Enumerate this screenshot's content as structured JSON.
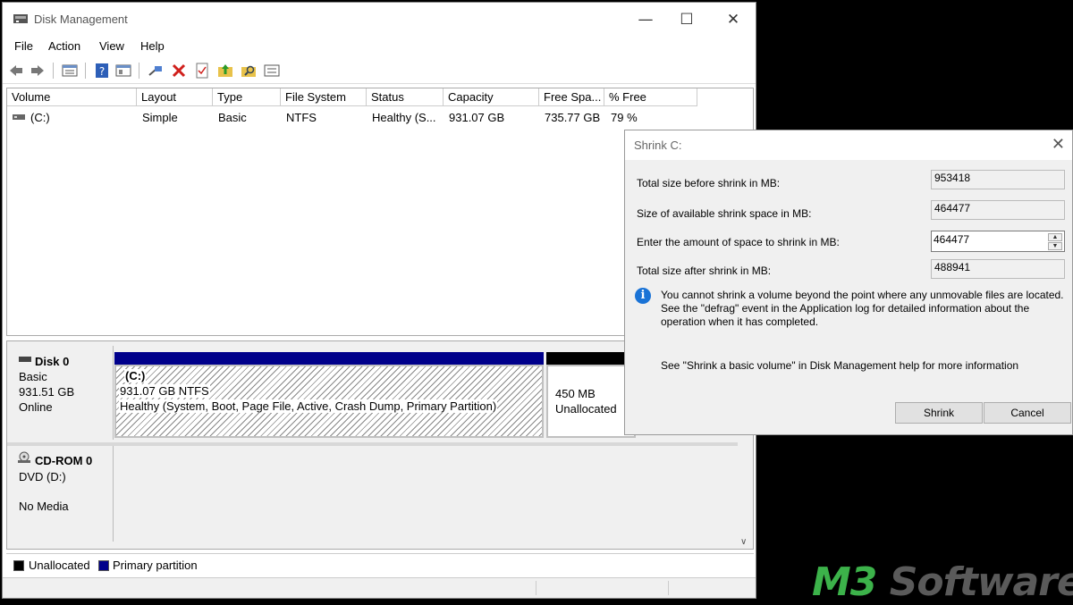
{
  "window": {
    "title": "Disk Management",
    "minimize": "—",
    "maximize": "☐",
    "close": "✕"
  },
  "menu": [
    "File",
    "Action",
    "View",
    "Help"
  ],
  "toolbar_icons": [
    "back-icon",
    "forward-icon",
    "disk-list-icon",
    "help-icon",
    "properties-icon",
    "connect-icon",
    "delete-icon",
    "checklist-icon",
    "folder-up-icon",
    "search-folder-icon",
    "settings-icon"
  ],
  "volume_list": {
    "columns": [
      "Volume",
      "Layout",
      "Type",
      "File System",
      "Status",
      "Capacity",
      "Free Spa...",
      "% Free"
    ],
    "rows": [
      [
        "(C:)",
        "Simple",
        "Basic",
        "NTFS",
        "Healthy (S...",
        "931.07 GB",
        "735.77 GB",
        "79 %"
      ]
    ]
  },
  "disks": {
    "disk0": {
      "name": "Disk 0",
      "type": "Basic",
      "size": "931.51 GB",
      "status": "Online",
      "partitions": [
        {
          "label": "(C:)",
          "size": "931.07 GB NTFS",
          "status": "Healthy (System, Boot, Page File, Active, Crash Dump, Primary Partition)"
        },
        {
          "size": "450 MB",
          "status": "Unallocated"
        }
      ]
    },
    "cdrom0": {
      "name": "CD-ROM 0",
      "drive": "DVD (D:)",
      "status": "No Media"
    }
  },
  "legend": [
    {
      "label": "Unallocated",
      "color": "#000000"
    },
    {
      "label": "Primary partition",
      "color": "#00008b"
    }
  ],
  "dialog": {
    "title": "Shrink C:",
    "total_before_label": "Total size before shrink in MB:",
    "total_before_value": "953418",
    "available_label": "Size of available shrink space in MB:",
    "available_value": "464477",
    "enter_label": "Enter the amount of space to shrink in MB:",
    "enter_value": "464477",
    "after_label": "Total size after shrink in MB:",
    "after_value": "488941",
    "info_line1": "You cannot shrink a volume beyond the point where any unmovable files are located.",
    "info_line2": "See the \"defrag\" event in the Application log for detailed information about the",
    "info_line3": "operation when it has completed.",
    "help_text": "See \"Shrink a basic volume\" in Disk Management help for more information",
    "shrink_button": "Shrink",
    "cancel_button": "Cancel"
  },
  "watermark": {
    "part1": "M3",
    "part2": " Software"
  }
}
